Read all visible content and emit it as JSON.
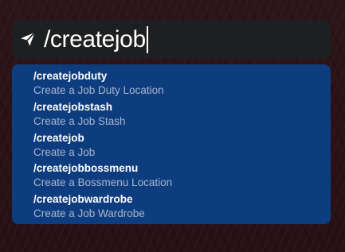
{
  "input": {
    "icon": "send-icon",
    "value": "/createjob"
  },
  "suggestions": [
    {
      "command": "/createjobduty",
      "description": "Create a Job Duty Location"
    },
    {
      "command": "/createjobstash",
      "description": "Create a Job Stash"
    },
    {
      "command": "/createjob",
      "description": "Create a Job"
    },
    {
      "command": "/createjobbossmenu",
      "description": "Create a Bossmenu Location"
    },
    {
      "command": "/createjobwardrobe",
      "description": "Create a Job Wardrobe"
    }
  ],
  "colors": {
    "background": "#2a1217",
    "input_bar": "#1e1f21",
    "suggestion_panel": "#0e3d7f",
    "command_text": "#ffffff",
    "description_text": "#a6b5cb"
  }
}
